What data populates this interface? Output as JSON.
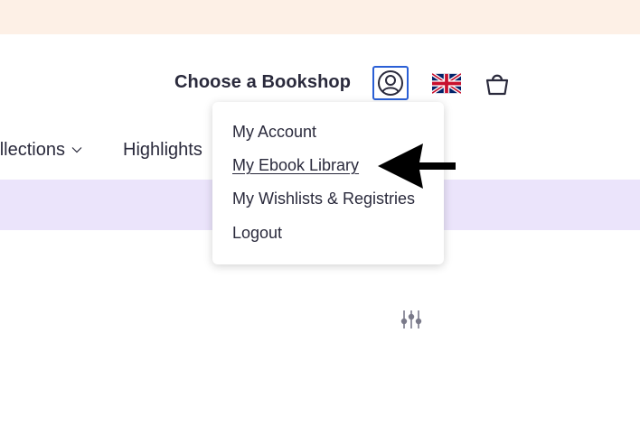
{
  "header": {
    "choose_bookshop": "Choose a Bookshop"
  },
  "icons": {
    "account": "user-circle-icon",
    "flag": "uk-flag-icon",
    "cart": "shopping-bag-icon",
    "filter": "sliders-icon",
    "chevron": "chevron-down-icon",
    "arrow": "left-arrow-annotation"
  },
  "nav": {
    "collections": "llections",
    "highlights": "Highlights"
  },
  "account_menu": {
    "items": [
      {
        "label": "My Account"
      },
      {
        "label": "My Ebook Library"
      },
      {
        "label": "My Wishlists & Registries"
      },
      {
        "label": "Logout"
      }
    ]
  },
  "colors": {
    "banner": "#fdf0e6",
    "promo_band": "#ebe4fb",
    "focus_ring": "#2a5fd6",
    "text": "#2a2a3c"
  }
}
